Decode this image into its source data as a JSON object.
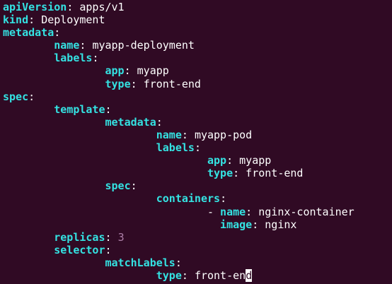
{
  "editor": {
    "colors": {
      "background": "#300a24",
      "key": "#34e2e2",
      "text": "#ffffff",
      "number": "#ad7fa8",
      "cursor": "#ffffff"
    },
    "lines": [
      {
        "indent": 0,
        "key": "apiVersion",
        "sep": ": ",
        "value": "apps/v1"
      },
      {
        "indent": 0,
        "key": "kind",
        "sep": ": ",
        "value": "Deployment"
      },
      {
        "indent": 0,
        "key": "metadata",
        "sep": ":"
      },
      {
        "indent": 1,
        "key": "name",
        "sep": ": ",
        "value": "myapp-deployment"
      },
      {
        "indent": 1,
        "key": "labels",
        "sep": ":"
      },
      {
        "indent": 2,
        "key": "app",
        "sep": ": ",
        "value": "myapp"
      },
      {
        "indent": 2,
        "key": "type",
        "sep": ": ",
        "value": "front-end"
      },
      {
        "indent": 0,
        "key": "spec",
        "sep": ":"
      },
      {
        "indent": 1,
        "key": "template",
        "sep": ":"
      },
      {
        "indent": 2,
        "key": "metadata",
        "sep": ":"
      },
      {
        "indent": 3,
        "key": "name",
        "sep": ": ",
        "value": "myapp-pod"
      },
      {
        "indent": 3,
        "key": "labels",
        "sep": ":"
      },
      {
        "indent": 4,
        "key": "app",
        "sep": ": ",
        "value": "myapp"
      },
      {
        "indent": 4,
        "key": "type",
        "sep": ": ",
        "value": "front-end"
      },
      {
        "indent": 2,
        "key": "spec",
        "sep": ":"
      },
      {
        "indent": 3,
        "key": "containers",
        "sep": ":"
      },
      {
        "indent": 4,
        "prefix": "- ",
        "key": "name",
        "sep": ": ",
        "value": "nginx-container"
      },
      {
        "indent": 4,
        "prefix": "  ",
        "key": "image",
        "sep": ": ",
        "value": "nginx"
      },
      {
        "indent": 1,
        "key": "replicas",
        "sep": ": ",
        "value": "3",
        "value_type": "number"
      },
      {
        "indent": 1,
        "key": "selector",
        "sep": ":"
      },
      {
        "indent": 2,
        "key": "matchLabels",
        "sep": ":"
      },
      {
        "indent": 3,
        "key": "type",
        "sep": ": ",
        "value": "front-en",
        "cursor_char": "d"
      }
    ]
  }
}
